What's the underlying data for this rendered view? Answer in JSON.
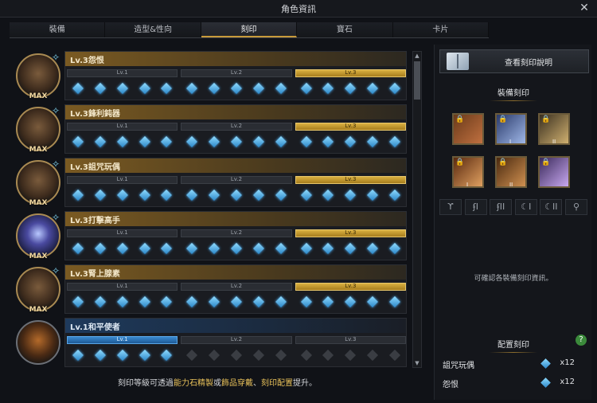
{
  "window": {
    "title": "角色資訊",
    "close_glyph": "✕"
  },
  "tabs": [
    "裝備",
    "造型&性向",
    "刻印",
    "寶石",
    "卡片"
  ],
  "active_tab": 2,
  "engravings": [
    {
      "title": "Lv.3怨恨",
      "badge": "MAX",
      "level": 3,
      "bar_color": "gold"
    },
    {
      "title": "Lv.3鋒利鈍器",
      "badge": "MAX",
      "level": 3,
      "bar_color": "gold"
    },
    {
      "title": "Lv.3詛咒玩偶",
      "badge": "MAX",
      "level": 3,
      "bar_color": "gold"
    },
    {
      "title": "Lv.3打擊高手",
      "badge": "MAX",
      "level": 3,
      "bar_color": "gold"
    },
    {
      "title": "Lv.3腎上腺素",
      "badge": "MAX",
      "level": 3,
      "bar_color": "gold"
    },
    {
      "title": "Lv.1和平使者",
      "badge": "",
      "level": 1,
      "bar_color": "blue"
    }
  ],
  "level_labels": [
    "Lv.1",
    "Lv.2",
    "Lv.3"
  ],
  "footer": {
    "p1": "刻印等級可透過",
    "h1": "能力石精製",
    "p2": "或",
    "h2": "飾品穿戴",
    "p3": "、",
    "h3": "刻印配置",
    "p4": "提升。"
  },
  "right_panel": {
    "view_button": "查看刻印說明",
    "equip_heading": "裝備刻印",
    "slot_badges": [
      "",
      "I",
      "II",
      "I",
      "II",
      ""
    ],
    "slot_icon_names": [
      "lock-icon",
      "lock-icon",
      "lock-icon",
      "lock-icon",
      "lock-icon",
      "lock-icon"
    ],
    "accessory_icons": [
      "ϒ",
      "ʄI",
      "ʄII",
      "☾I",
      "☾II",
      "⚲"
    ],
    "info_text": "可確認各裝備刻印資訊。",
    "config_heading": "配置刻印",
    "help_glyph": "?",
    "config": [
      {
        "name": "詛咒玩偶",
        "count": "x12"
      },
      {
        "name": "怨恨",
        "count": "x12"
      }
    ]
  },
  "colors": {
    "accent_gold": "#c79a3a",
    "gem_blue": "#2b86c8",
    "help_green": "#3b8a3b"
  }
}
